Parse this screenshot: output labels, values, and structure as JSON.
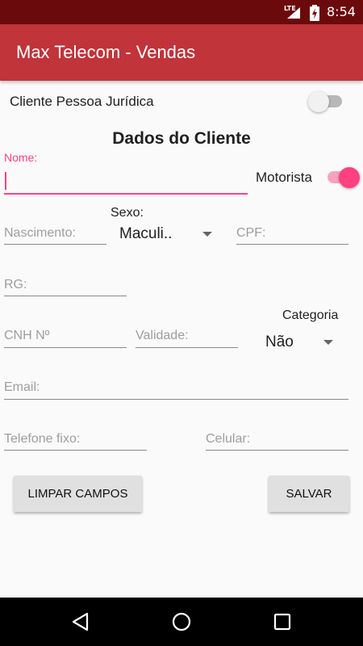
{
  "status_bar": {
    "network": "LTE",
    "time": "8:54"
  },
  "app_bar": {
    "title": "Max Telecom - Vendas"
  },
  "form": {
    "pessoa_juridica_label": "Cliente Pessoa Jurídica",
    "pessoa_juridica_on": false,
    "section_title": "Dados do Cliente",
    "nome_label": "Nome:",
    "nome_value": "",
    "motorista_label": "Motorista",
    "motorista_on": true,
    "sexo_label": "Sexo:",
    "sexo_value": "Maculi..",
    "nascimento_placeholder": "Nascimento:",
    "cpf_placeholder": "CPF:",
    "rg_placeholder": "RG:",
    "categoria_label": "Categoria",
    "categoria_value": "Não",
    "cnh_placeholder": "CNH Nº",
    "validade_placeholder": "Validade:",
    "email_placeholder": "Email:",
    "telefone_placeholder": "Telefone fixo:",
    "celular_placeholder": "Celular:"
  },
  "buttons": {
    "limpar": "LIMPAR CAMPOS",
    "salvar": "SALVAR"
  },
  "colors": {
    "accent": "#ff4081",
    "primary": "#c0343a",
    "primary_dark": "#6b0a0c"
  }
}
